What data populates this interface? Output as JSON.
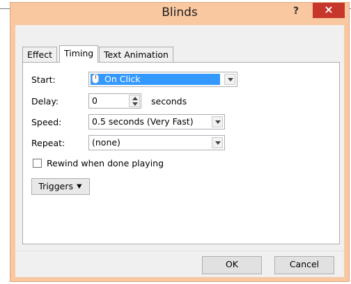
{
  "window": {
    "title": "Blinds",
    "help_label": "?",
    "close_label": "×"
  },
  "tabs": [
    {
      "label": "Effect"
    },
    {
      "label": "Timing"
    },
    {
      "label": "Text Animation"
    }
  ],
  "timing": {
    "start_label": "Start:",
    "start_value": "On Click",
    "delay_label": "Delay:",
    "delay_value": "0",
    "delay_unit": "seconds",
    "speed_label": "Speed:",
    "speed_value": "0.5 seconds (Very Fast)",
    "repeat_label": "Repeat:",
    "repeat_value": "(none)",
    "rewind_label": "Rewind when done playing",
    "triggers_label": "Triggers"
  },
  "buttons": {
    "ok": "OK",
    "cancel": "Cancel"
  },
  "icons": {
    "start_icon": "mouse-icon",
    "triggers_icon": "double-chevron-down-icon",
    "dropdown_icon": "chevron-down-icon"
  },
  "colors": {
    "frame": "#f9c8a1",
    "close": "#c7362b",
    "selection": "#3399ff"
  }
}
